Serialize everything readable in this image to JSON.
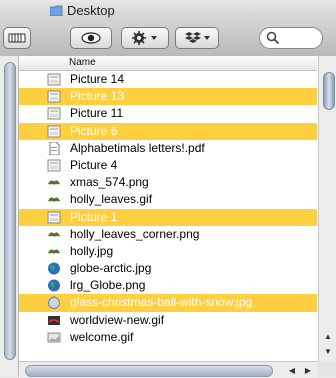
{
  "window": {
    "title": "Desktop"
  },
  "toolbar": {
    "view_icon": "list-view-icon",
    "quicklook_icon": "eye-icon",
    "action_icon": "gear-icon",
    "dropbox_icon": "dropbox-icon",
    "search_icon": "magnifier-icon"
  },
  "list": {
    "header_name": "Name",
    "selection_color": "#ffcf3f",
    "rows": [
      {
        "label": "Picture 14",
        "selected": false,
        "icon": "screenshot-icon"
      },
      {
        "label": "Picture 13",
        "selected": true,
        "icon": "screenshot-icon"
      },
      {
        "label": "Picture 11",
        "selected": false,
        "icon": "screenshot-icon"
      },
      {
        "label": "Picture 6",
        "selected": true,
        "icon": "screenshot-icon"
      },
      {
        "label": "Alphabetimals letters!.pdf",
        "selected": false,
        "icon": "pdf-icon"
      },
      {
        "label": "Picture 4",
        "selected": false,
        "icon": "screenshot-icon"
      },
      {
        "label": "xmas_574.png",
        "selected": false,
        "icon": "holly-icon"
      },
      {
        "label": "holly_leaves.gif",
        "selected": false,
        "icon": "holly-icon"
      },
      {
        "label": "Picture 1",
        "selected": true,
        "icon": "screenshot-icon"
      },
      {
        "label": "holly_leaves_corner.png",
        "selected": false,
        "icon": "holly-icon"
      },
      {
        "label": "holly.jpg",
        "selected": false,
        "icon": "holly-icon"
      },
      {
        "label": "globe-arctic.jpg",
        "selected": false,
        "icon": "globe-icon"
      },
      {
        "label": "lrg_Globe.png",
        "selected": false,
        "icon": "globe-icon"
      },
      {
        "label": "glass-christmas-ball-with-snow.jpg",
        "selected": true,
        "icon": "ornament-icon"
      },
      {
        "label": "worldview-new.gif",
        "selected": false,
        "icon": "worldview-icon"
      },
      {
        "label": "welcome.gif",
        "selected": false,
        "icon": "image-icon"
      }
    ]
  }
}
